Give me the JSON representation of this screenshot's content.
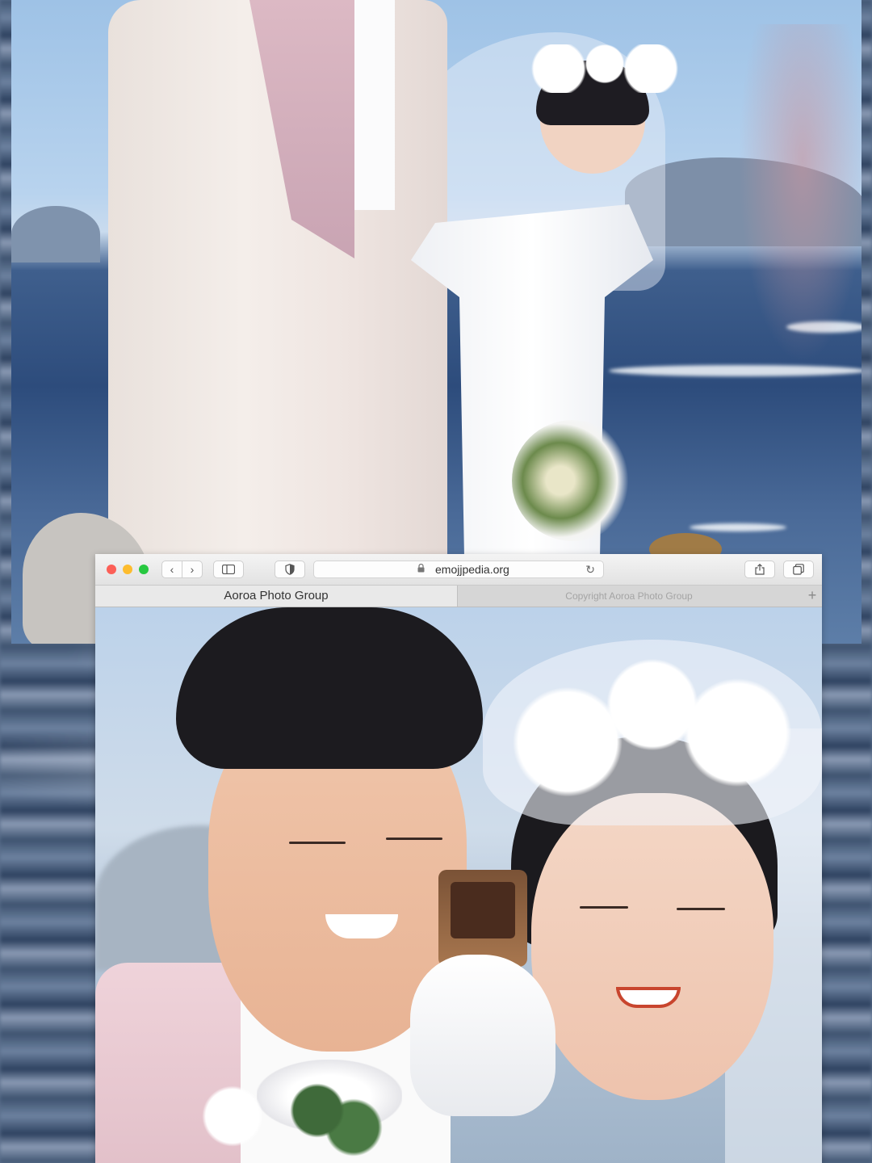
{
  "browser": {
    "url": "emojjpedia.org",
    "tabs": [
      {
        "label": "Aoroa Photo Group",
        "active": true
      },
      {
        "label": "Copyright Aoroa Photo Group",
        "active": false
      }
    ],
    "buttons": {
      "back": "‹",
      "forward": "›",
      "reload": "↻",
      "new_tab": "+"
    },
    "traffic_lights": {
      "close": "#fc5f57",
      "minimize": "#fdbc2e",
      "zoom": "#27c840"
    }
  },
  "icons": {
    "sidebar": "sidebar-icon",
    "shield": "shield-icon",
    "lock": "lock-icon",
    "share": "share-icon",
    "tabs_overview": "tabs-overview-icon"
  }
}
